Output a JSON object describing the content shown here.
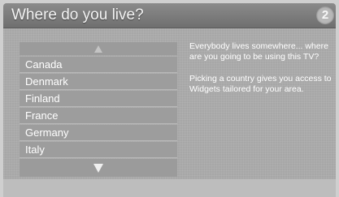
{
  "header": {
    "title": "Where do you live?",
    "step": "2"
  },
  "country_list": {
    "items": [
      "Canada",
      "Denmark",
      "Finland",
      "France",
      "Germany",
      "Italy"
    ]
  },
  "info": {
    "paragraph1": "Everybody lives somewhere... where are you going to be using this TV?",
    "paragraph2": "Picking a country gives you access to Widgets tailored for your area."
  },
  "icons": {
    "scroll_up": "chevron-up-icon",
    "scroll_down": "chevron-down-icon"
  },
  "colors": {
    "title_bar": "#7c7c7c",
    "panel": "#a7a7a7",
    "list_item": "#9d9d9d"
  }
}
